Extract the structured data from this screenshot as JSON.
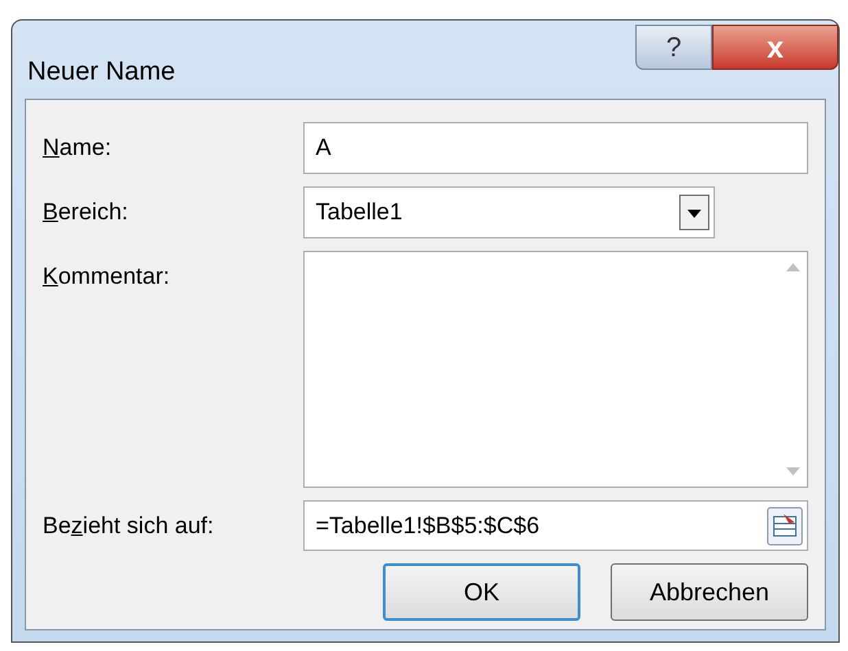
{
  "window": {
    "title": "Neuer Name",
    "help_button": "?",
    "close_button": "x"
  },
  "fields": [
    {
      "kind": "text",
      "access_key": "N",
      "label_after": "ame:",
      "value": "A"
    },
    {
      "kind": "select",
      "access_key": "B",
      "label_after": "ereich:",
      "value": "Tabelle1"
    },
    {
      "kind": "textarea",
      "access_key": "K",
      "label_after": "ommentar:"
    },
    {
      "kind": "reference",
      "label_before": "Be",
      "access_key": "z",
      "label_after": "ieht sich auf:",
      "value": "=Tabelle1!$B$5:$C$6"
    }
  ],
  "buttons": [
    {
      "label": "OK",
      "default": true
    },
    {
      "label": "Abbrechen",
      "default": false
    }
  ]
}
